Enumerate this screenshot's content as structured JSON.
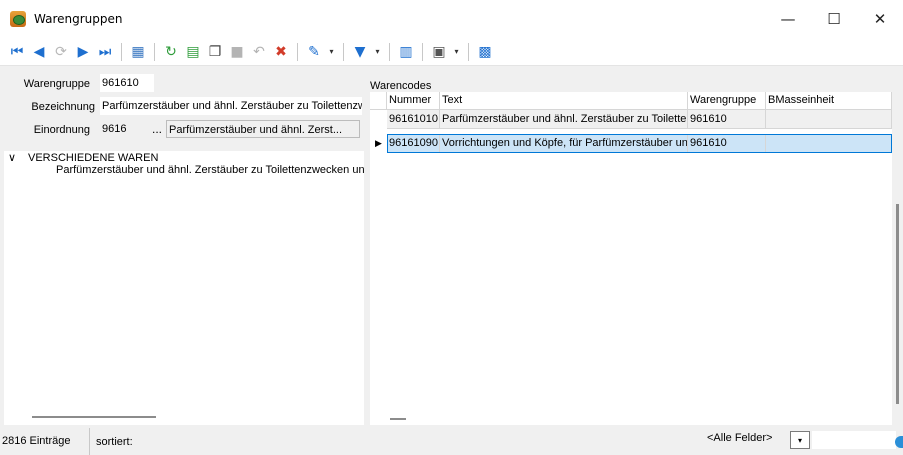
{
  "window": {
    "title": "Warengruppen",
    "minimize": "—",
    "maximize": "☐",
    "close": "✕"
  },
  "toolbar": {
    "buttons": [
      {
        "name": "first-record-icon",
        "glyph": "⏮",
        "color": "#1e6fcf"
      },
      {
        "name": "previous-record-icon",
        "glyph": "◀",
        "color": "#1e6fcf"
      },
      {
        "name": "search-record-icon",
        "glyph": "⟳",
        "color": "#b8b8b8"
      },
      {
        "name": "next-record-icon",
        "glyph": "▶",
        "color": "#1e6fcf"
      },
      {
        "name": "last-record-icon",
        "glyph": "⏭",
        "color": "#1e6fcf"
      },
      {
        "name": "table-view-icon",
        "glyph": "▦",
        "color": "#3a78c2"
      },
      {
        "name": "refresh-icon",
        "glyph": "↻",
        "color": "#2e9c3a"
      },
      {
        "name": "new-record-icon",
        "glyph": "▤",
        "color": "#2e9c3a"
      },
      {
        "name": "copy-record-icon",
        "glyph": "❐",
        "color": "#444444"
      },
      {
        "name": "save-icon",
        "glyph": "■",
        "color": "#b4b4b4"
      },
      {
        "name": "undo-icon",
        "glyph": "↶",
        "color": "#b4b4b4"
      },
      {
        "name": "delete-icon",
        "glyph": "✖",
        "color": "#d23c2a"
      },
      {
        "name": "pin-icon",
        "glyph": "✎",
        "color": "#1e6fcf"
      },
      {
        "name": "filter-icon",
        "glyph": "▼",
        "color": "#1e6fcf"
      },
      {
        "name": "book-icon",
        "glyph": "▥",
        "color": "#1e6fcf"
      },
      {
        "name": "print-icon",
        "glyph": "▣",
        "color": "#555555"
      },
      {
        "name": "calculator-icon",
        "glyph": "▩",
        "color": "#1e6fcf"
      }
    ],
    "dropdown_glyph": "▾"
  },
  "form": {
    "warengruppe_label": "Warengruppe",
    "warengruppe_value": "961610",
    "bezeichnung_label": "Bezeichnung",
    "bezeichnung_value": "Parfümzerstäuber und ähnl. Zerstäuber zu Toilettenzwe",
    "einordnung_label": "Einordnung",
    "einordnung_value": "9616",
    "einordnung_browse": "...",
    "einordnung_text": "Parfümzerstäuber und ähnl. Zerst..."
  },
  "tree": {
    "expander": "∨",
    "node": "VERSCHIEDENE WAREN",
    "child": "Parfümzerstäuber und ähnl. Zerstäuber zu Toilettenzwecken und"
  },
  "warencodes": {
    "label": "Warencodes",
    "columns": [
      "Nummer",
      "Text",
      "Warengruppe",
      "BMasseinheit"
    ],
    "rows": [
      {
        "nummer": "96161010",
        "text": "Parfümzerstäuber und ähnl. Zerstäuber zu Toiletten:",
        "warengruppe": "961610",
        "bmasseinheit": "",
        "indicator": ""
      },
      {
        "nummer": "96161090",
        "text": "Vorrichtungen und Köpfe, für Parfümzerstäuber und",
        "warengruppe": "961610",
        "bmasseinheit": "",
        "indicator": "▶"
      }
    ]
  },
  "status": {
    "count": "2816 Einträge",
    "sort": "sortiert:",
    "filter": "<Alle Felder>",
    "combo_glyph": "▾"
  }
}
